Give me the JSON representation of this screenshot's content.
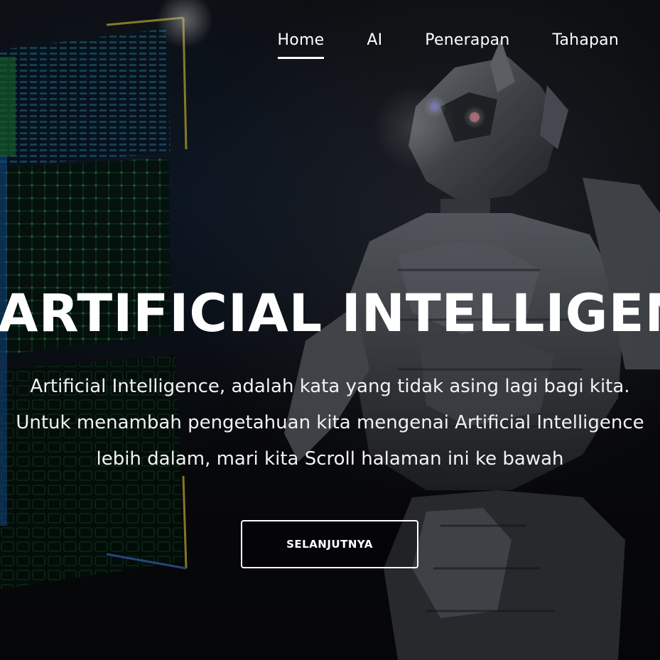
{
  "nav": {
    "items": [
      {
        "label": "Home",
        "active": true
      },
      {
        "label": "AI",
        "active": false
      },
      {
        "label": "Penerapan",
        "active": false
      },
      {
        "label": "Tahapan",
        "active": false
      }
    ]
  },
  "hero": {
    "title": "ARTIFICIAL INTELLIGENCE",
    "description_lines": [
      "Artificial Intelligence, adalah kata yang tidak asing lagi bagi kita.",
      "Untuk menambah pengetahuan kita mengenai Artificial Intelligence",
      "lebih dalam, mari kita Scroll halaman ini ke bawah"
    ],
    "cta_label": "SELANJUTNYA"
  },
  "colors": {
    "text": "#ffffff",
    "background": "#0b0c0e",
    "circuit_green": "#2fa84f",
    "circuit_blue": "#2a5fb0",
    "frame_yellow": "#d8c23a"
  }
}
